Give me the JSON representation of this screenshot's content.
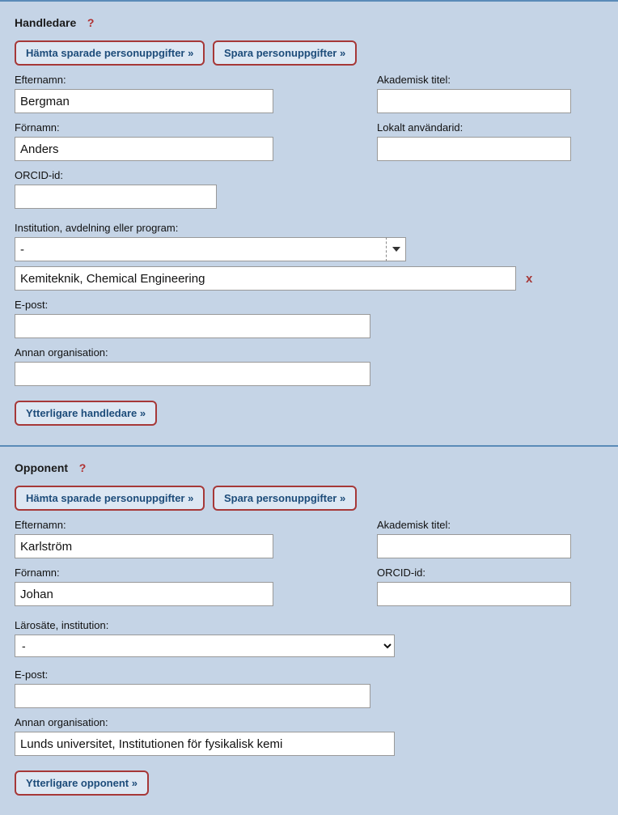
{
  "handledare": {
    "title": "Handledare",
    "help": "?",
    "buttons": {
      "load": "Hämta sparade personuppgifter »",
      "save": "Spara personuppgifter »",
      "add": "Ytterligare handledare »"
    },
    "labels": {
      "efternamn": "Efternamn:",
      "fornamn": "Förnamn:",
      "orcid": "ORCID-id:",
      "akademisk": "Akademisk titel:",
      "anvandarid": "Lokalt användarid:",
      "institution": "Institution, avdelning eller program:",
      "epost": "E-post:",
      "annan": "Annan organisation:"
    },
    "values": {
      "efternamn": "Bergman",
      "fornamn": "Anders",
      "orcid": "",
      "akademisk": "",
      "anvandarid": "",
      "institution_combo": "-",
      "institution_selected": "Kemiteknik, Chemical Engineering",
      "epost": "",
      "annan": ""
    },
    "remove_icon": "x"
  },
  "opponent": {
    "title": "Opponent",
    "help": "?",
    "buttons": {
      "load": "Hämta sparade personuppgifter »",
      "save": "Spara personuppgifter »",
      "add": "Ytterligare opponent »"
    },
    "labels": {
      "efternamn": "Efternamn:",
      "fornamn": "Förnamn:",
      "akademisk": "Akademisk titel:",
      "orcid": "ORCID-id:",
      "larosate": "Lärosäte, institution:",
      "epost": "E-post:",
      "annan": "Annan organisation:"
    },
    "values": {
      "efternamn": "Karlström",
      "fornamn": "Johan",
      "akademisk": "",
      "orcid": "",
      "larosate": "-",
      "epost": "",
      "annan": "Lunds universitet, Institutionen för fysikalisk kemi"
    }
  }
}
